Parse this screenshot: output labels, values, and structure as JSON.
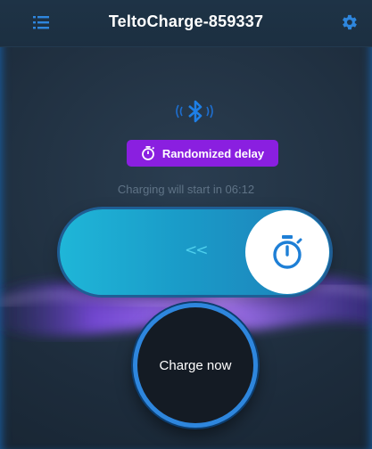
{
  "header": {
    "title": "TeltoCharge-859337",
    "menu_icon": "list-menu-icon",
    "settings_icon": "gear-icon"
  },
  "connection": {
    "icon": "bluetooth-icon"
  },
  "mode_badge": {
    "icon": "stopwatch-icon",
    "label": "Randomized delay"
  },
  "status": {
    "text": "Charging will start in 06:12"
  },
  "slider": {
    "arrows": "<<",
    "knob_icon": "stopwatch-icon"
  },
  "charge_button": {
    "label": "Charge now"
  },
  "colors": {
    "accent": "#2e86dd",
    "badge": "#8a1fe0",
    "slider_start": "#1fb6d8",
    "slider_end": "#1e7fb9"
  }
}
